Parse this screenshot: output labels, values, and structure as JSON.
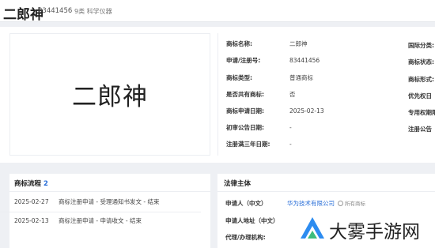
{
  "header": {
    "title": "二郎神",
    "reg_no": "83441456",
    "class_label": "9类 科学仪器"
  },
  "mark_image": {
    "text": "二郎神"
  },
  "info": [
    {
      "label": "商标名称:",
      "value": "二郎神"
    },
    {
      "label": "申请/注册号:",
      "value": "83441456"
    },
    {
      "label": "商标类型:",
      "value": "普通商标"
    },
    {
      "label": "是否共有商标:",
      "value": "否"
    },
    {
      "label": "商标申请日期:",
      "value": "2025-02-13"
    },
    {
      "label": "初审公告日期:",
      "value": "-"
    },
    {
      "label": "注册满三年日期:",
      "value": "-"
    }
  ],
  "right_labels": [
    "国际分类:",
    "商标状态:",
    "商标形式:",
    "优先权日",
    "专用权期限",
    "注册公告"
  ],
  "flow": {
    "title": "商标流程",
    "count": "2",
    "items": [
      {
        "date": "2025-02-27",
        "text": "商标注册申请 - 受理通知书发文 - 结束"
      },
      {
        "date": "2025-02-13",
        "text": "商标注册申请 - 申请收文 - 结束"
      }
    ]
  },
  "legal": {
    "title": "法律主体",
    "applicant_label": "申请人（中文）",
    "applicant_value": "华为技术有限公司",
    "all_marks_label": "所有商标",
    "address_label": "申请人地址（中文）",
    "agent_label": "代理/办理机构:"
  },
  "watermark": {
    "text": "大雾手游网"
  },
  "colors": {
    "link": "#2a6fd8",
    "logo_blue": "#2d8cf0",
    "logo_green": "#3dbd7d"
  }
}
